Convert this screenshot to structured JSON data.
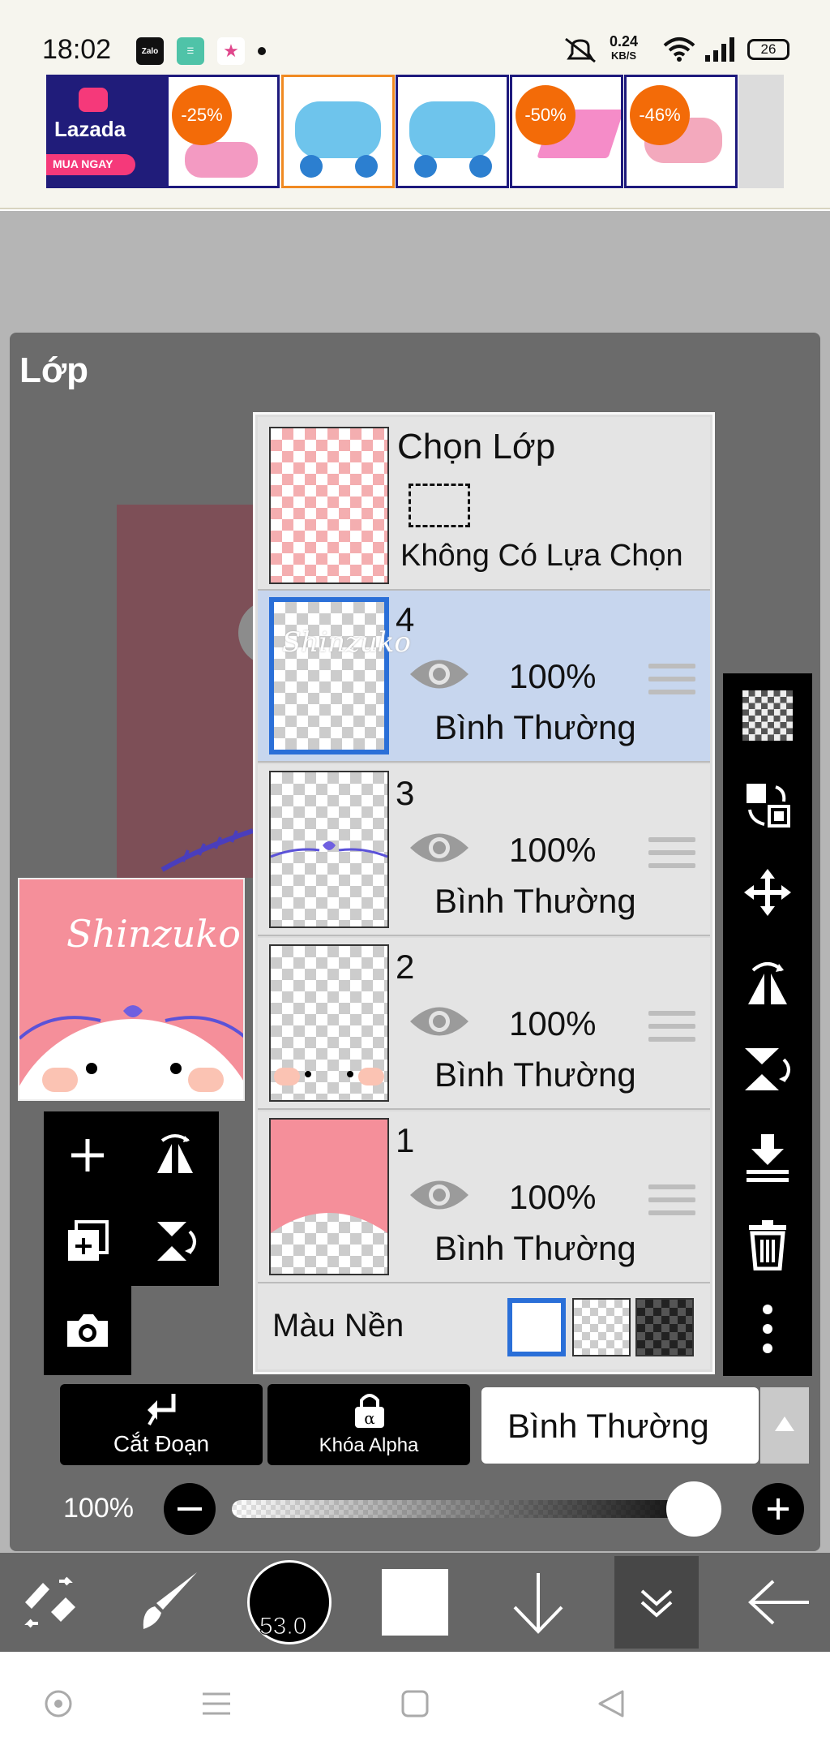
{
  "status_bar": {
    "time": "18:02",
    "app_icons": [
      "zalo-icon",
      "app-icon",
      "star-app-icon"
    ],
    "net_speed": "0.24",
    "net_unit": "KB/S",
    "battery": "26"
  },
  "ad_banner": {
    "brand": "Lazada",
    "cta": "MUA NGAY",
    "products": [
      {
        "badge": "-25%"
      },
      {
        "badge": ""
      },
      {
        "badge": ""
      },
      {
        "badge": "-50%"
      },
      {
        "badge": "-46%"
      }
    ]
  },
  "panel": {
    "title": "Lớp"
  },
  "preview": {
    "signature": "Shinzuko"
  },
  "selection": {
    "title": "Chọn Lớp",
    "status": "Không Có Lựa Chọn"
  },
  "layers": [
    {
      "number": "4",
      "opacity": "100%",
      "blend": "Bình Thường",
      "selected": true
    },
    {
      "number": "3",
      "opacity": "100%",
      "blend": "Bình Thường",
      "selected": false
    },
    {
      "number": "2",
      "opacity": "100%",
      "blend": "Bình Thường",
      "selected": false
    },
    {
      "number": "1",
      "opacity": "100%",
      "blend": "Bình Thường",
      "selected": false
    }
  ],
  "background": {
    "label": "Màu Nền",
    "options": [
      "white",
      "transparent",
      "dark-checker"
    ],
    "selected": "white"
  },
  "controls": {
    "clip_label": "Cắt Đoạn",
    "alpha_lock_label": "Khóa Alpha",
    "blend_mode": "Bình Thường",
    "opacity_label": "100%",
    "opacity_value": 1.0
  },
  "bottom_toolbar": {
    "brush_size": "53.0"
  },
  "colors": {
    "accent": "#2a6fd8",
    "selected_row": "#c7d6ee",
    "layer_fill_pink": "#f58f9a",
    "panel": "#6b6b6b",
    "toolbar": "#666666"
  }
}
